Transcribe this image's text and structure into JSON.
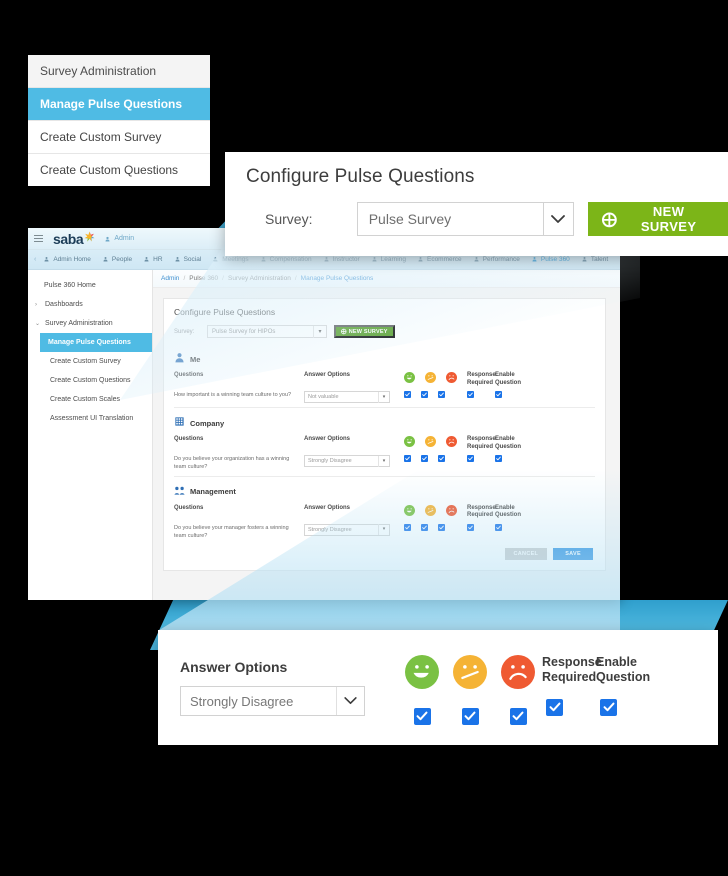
{
  "menu_card": {
    "items": [
      {
        "label": "Survey Administration",
        "state": "header"
      },
      {
        "label": "Manage Pulse Questions",
        "state": "active"
      },
      {
        "label": "Create Custom Survey",
        "state": "plain"
      },
      {
        "label": "Create Custom Questions",
        "state": "plain"
      }
    ]
  },
  "callout": {
    "title": "Configure Pulse Questions",
    "survey_label": "Survey:",
    "survey_value": "Pulse Survey",
    "new_survey_button": "NEW SURVEY",
    "plus_icon": "⊕",
    "caret_icon": "⌄"
  },
  "app": {
    "logo_text": "saba",
    "admin_chip": "Admin",
    "hamburger_icon": "hamburger-icon",
    "nav_items": [
      {
        "label": "Admin Home",
        "active": false
      },
      {
        "label": "People",
        "active": false
      },
      {
        "label": "HR",
        "active": false
      },
      {
        "label": "Social",
        "active": false
      },
      {
        "label": "Meetings",
        "active": false
      },
      {
        "label": "Compensation",
        "active": false
      },
      {
        "label": "Instructor",
        "active": false
      },
      {
        "label": "Learning",
        "active": false
      },
      {
        "label": "Ecommerce",
        "active": false
      },
      {
        "label": "Performance",
        "active": false
      },
      {
        "label": "Pulse 360",
        "active": true
      },
      {
        "label": "Talent",
        "active": false
      }
    ],
    "sidebar": [
      {
        "label": "Pulse 360 Home",
        "chev": "",
        "state": "normal"
      },
      {
        "label": "Dashboards",
        "chev": "›",
        "state": "normal"
      },
      {
        "label": "Survey Administration",
        "chev": "⌄",
        "state": "normal"
      },
      {
        "label": "Manage Pulse Questions",
        "chev": "",
        "state": "active"
      },
      {
        "label": "Create Custom Survey",
        "chev": "",
        "state": "sub"
      },
      {
        "label": "Create Custom Questions",
        "chev": "",
        "state": "sub"
      },
      {
        "label": "Create Custom Scales",
        "chev": "",
        "state": "sub"
      },
      {
        "label": "Assessment UI Translation",
        "chev": "",
        "state": "sub"
      }
    ],
    "breadcrumb": [
      {
        "label": "Admin",
        "link": true
      },
      {
        "label": "Pulse 360",
        "link": false
      },
      {
        "label": "Survey Administration",
        "link": false
      },
      {
        "label": "Manage Pulse Questions",
        "link": true
      }
    ],
    "breadcrumb_sep": "/",
    "page_title": "Configure Pulse Questions",
    "survey_label": "Survey:",
    "survey_value": "Pulse Survey for HIPOs",
    "new_survey_button": "NEW SURVEY",
    "columns": {
      "questions": "Questions",
      "answer_options": "Answer Options",
      "response_required": "Response Required",
      "enable_question": "Enable Question"
    },
    "sections": [
      {
        "name": "Me",
        "icon": "person-icon",
        "question": "How important is a winning team culture to you?",
        "answer_value": "Not valuable",
        "checks": [
          true,
          true,
          true,
          true,
          true
        ]
      },
      {
        "name": "Company",
        "icon": "building-icon",
        "question": "Do you believe your organization has a winning team culture?",
        "answer_value": "Strongly Disagree",
        "checks": [
          true,
          true,
          true,
          true,
          true
        ]
      },
      {
        "name": "Management",
        "icon": "people-icon",
        "question": "Do you believe your manager fosters a winning team culture?",
        "answer_value": "Strongly Disagree",
        "checks": [
          true,
          true,
          true,
          true,
          true
        ]
      }
    ],
    "cancel_button": "CANCEL",
    "save_button": "SAVE"
  },
  "zoom_panel": {
    "answer_options_label": "Answer Options",
    "answer_value": "Strongly Disagree",
    "response_required_line1": "Response",
    "response_required_line2": "Required",
    "enable_question_line1": "Enable",
    "enable_question_line2": "Question",
    "caret_icon": "⌄",
    "faces": [
      {
        "name": "happy-face-icon",
        "color": "#7ac143"
      },
      {
        "name": "neutral-face-icon",
        "color": "#f5b335"
      },
      {
        "name": "sad-face-icon",
        "color": "#ef5a32"
      }
    ],
    "checkboxes": [
      true,
      true,
      true,
      true,
      true
    ]
  },
  "colors": {
    "accent_blue": "#4fbbe4",
    "green_button": "#7cb518",
    "save_blue": "#2b8fe0",
    "checkbox_blue": "#1a73e8",
    "happy_green": "#7ac143",
    "neutral_yellow": "#f5b335",
    "sad_red": "#ef5a32",
    "background": "#000000"
  }
}
